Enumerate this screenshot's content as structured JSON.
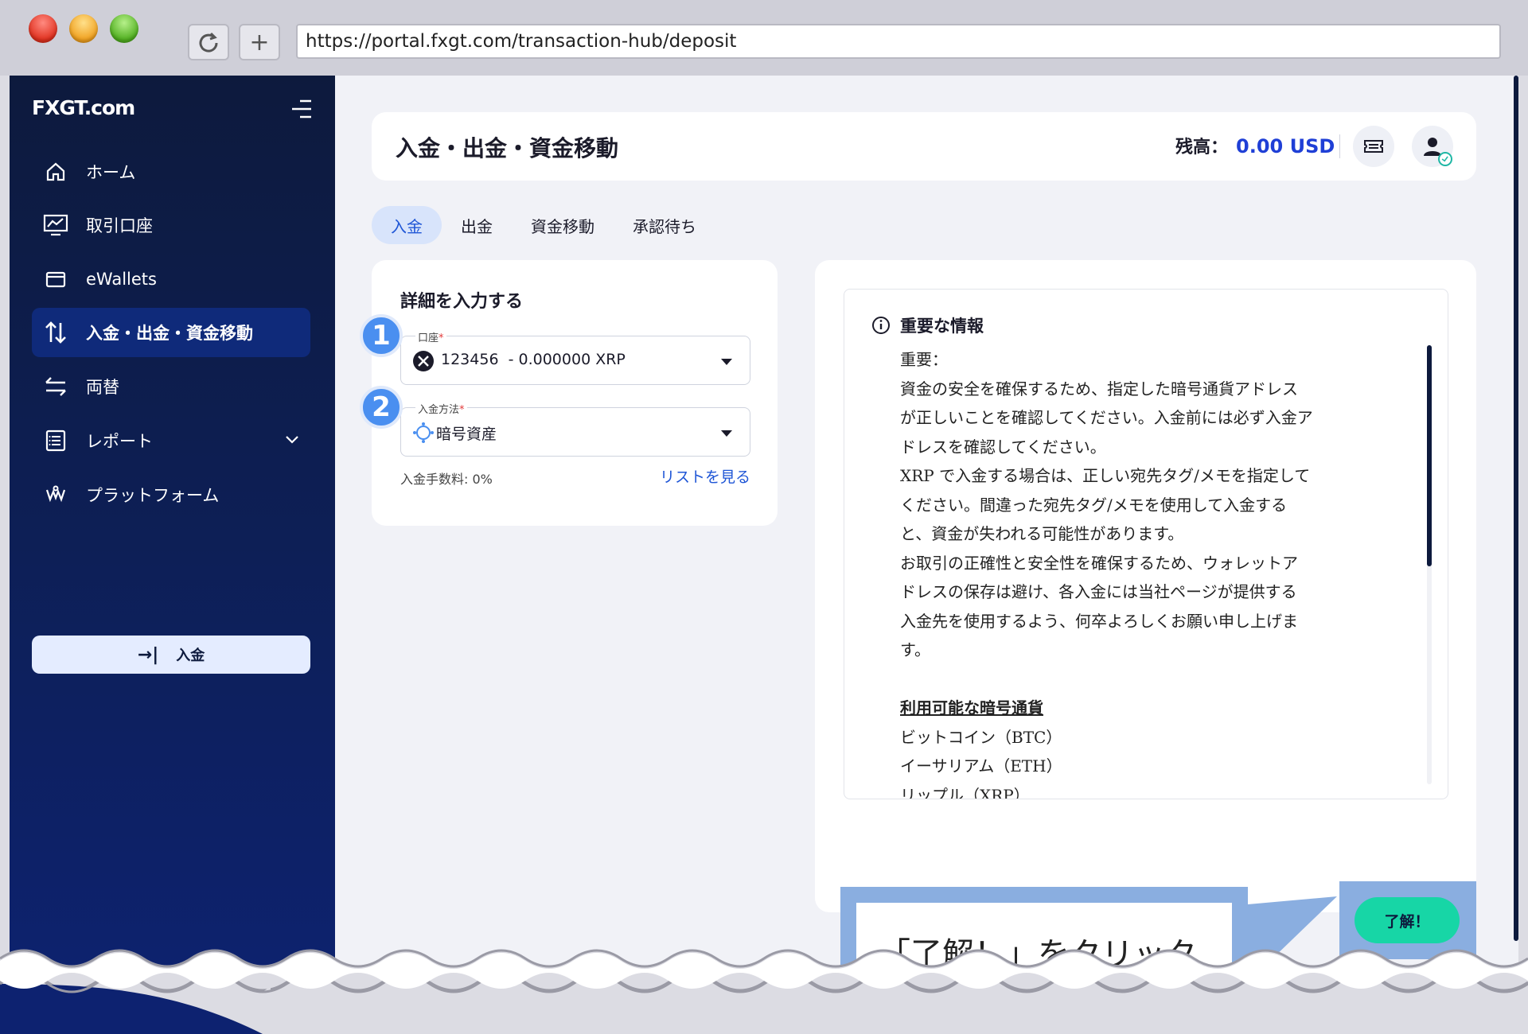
{
  "browser": {
    "url": "https://portal.fxgt.com/transaction-hub/deposit",
    "reload_icon": "reload-icon",
    "newtab_icon": "plus-icon"
  },
  "sidebar": {
    "logo": "FXGT.com",
    "items": [
      {
        "label": "ホーム",
        "icon": "home-icon"
      },
      {
        "label": "取引口座",
        "icon": "chart-monitor-icon"
      },
      {
        "label": "eWallets",
        "icon": "wallet-icon"
      },
      {
        "label": "入金・出金・資金移動",
        "icon": "transfer-arrows-icon",
        "active": true
      },
      {
        "label": "両替",
        "icon": "exchange-icon"
      },
      {
        "label": "レポート",
        "icon": "report-icon"
      },
      {
        "label": "プラットフォーム",
        "icon": "platform-icon"
      }
    ],
    "deposit_button": "入金"
  },
  "header": {
    "title": "入金・出金・資金移動",
    "balance_label": "残高：",
    "balance_value": "0.00 USD"
  },
  "tabs": [
    "入金",
    "出金",
    "資金移動",
    "承認待ち"
  ],
  "form": {
    "title": "詳細を入力する",
    "account_label": "口座",
    "account_value": "123456  - 0.000000 XRP",
    "method_label": "入金方法",
    "method_value": "暗号資産",
    "fee": "入金手数料: 0%",
    "list_link": "リストを見る",
    "badge1": "1",
    "badge2": "2"
  },
  "info": {
    "heading": "重要な情報",
    "lines": [
      "重要：",
      "資金の安全を確保するため、指定した暗号通貨アドレス",
      "が正しいことを確認してください。入金前には必ず入金ア",
      "ドレスを確認してください。",
      "XRP で入金する場合は、正しい宛先タグ/メモを指定して",
      "ください。間違った宛先タグ/メモを使用して入金する",
      "と、資金が失われる可能性があります。",
      "お取引の正確性と安全性を確保するため、ウォレットア",
      "ドレスの保存は避け、各入金には当社ページが提供する",
      "入金先を使用するよう、何卒よろしくお願い申し上げま",
      "す。"
    ],
    "currencies_title": "利用可能な暗号通貨",
    "currencies": [
      "ビットコイン（BTC）",
      "イーサリアム（ETH）",
      "リップル（XRP）"
    ],
    "ok_button": "了解！"
  },
  "callout": {
    "text": "「了解！」をクリック"
  },
  "colors": {
    "sidebar": "#0d1f56",
    "accent": "#1f56d6",
    "ok": "#17d6a6",
    "callout": "#8aaee0"
  }
}
